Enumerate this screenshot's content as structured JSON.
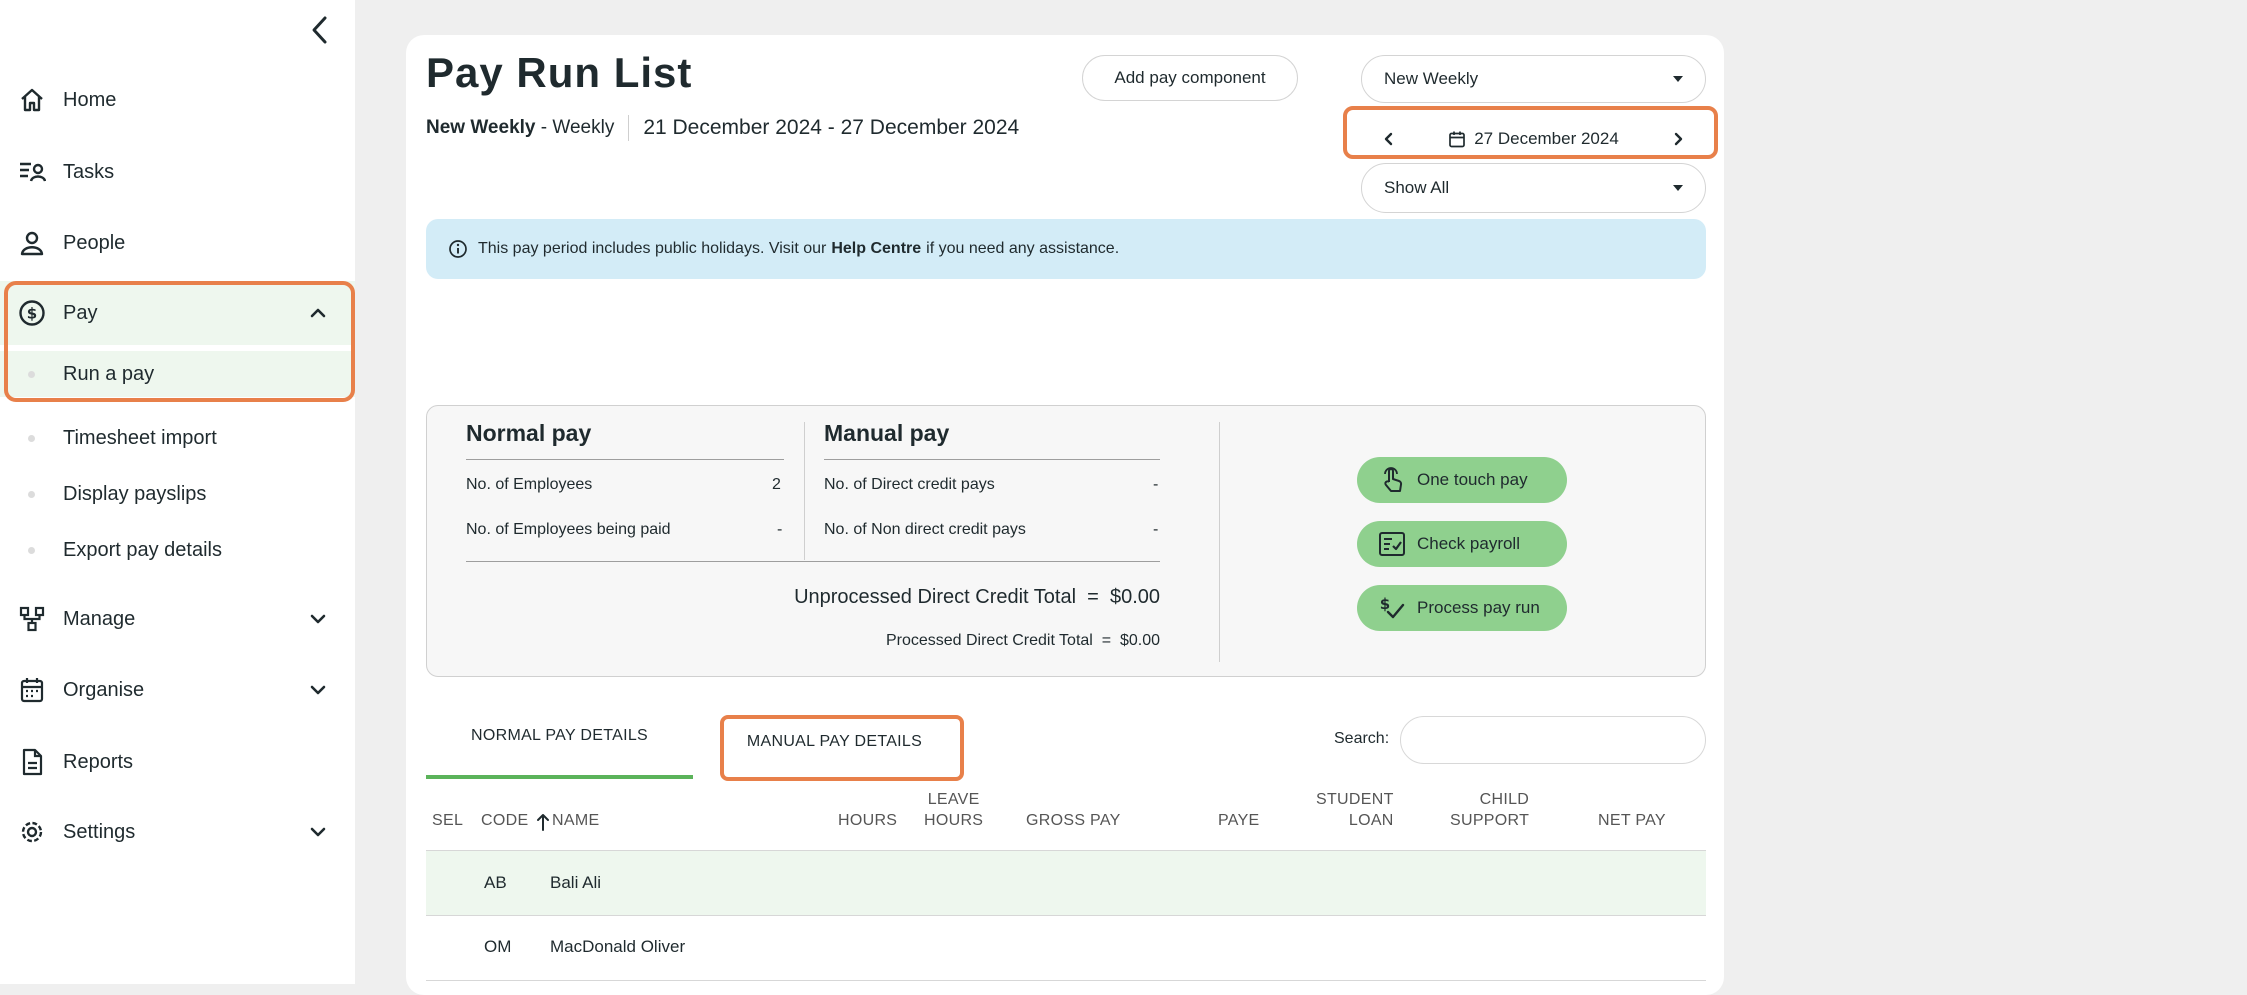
{
  "sidebar": {
    "items": [
      {
        "label": "Home",
        "icon": "home-icon"
      },
      {
        "label": "Tasks",
        "icon": "tasks-icon"
      },
      {
        "label": "People",
        "icon": "person-icon"
      },
      {
        "label": "Pay",
        "icon": "dollar-circle-icon",
        "expanded": true
      },
      {
        "label": "Manage",
        "icon": "hierarchy-icon"
      },
      {
        "label": "Organise",
        "icon": "calendar-icon"
      },
      {
        "label": "Reports",
        "icon": "document-icon"
      },
      {
        "label": "Settings",
        "icon": "gear-icon"
      }
    ],
    "pay_subitems": [
      "Run a pay",
      "Timesheet import",
      "Display payslips",
      "Export pay details"
    ],
    "active_subitem": "Run a pay"
  },
  "header": {
    "title": "Pay Run List",
    "subtitle_bold": "New Weekly",
    "subtitle_freq": " - Weekly",
    "date_range": "21 December 2024 - 27 December 2024",
    "add_component_label": "Add pay component",
    "pay_group_value": "New Weekly",
    "date_value": "27 December 2024",
    "filter_value": "Show All"
  },
  "alert": {
    "pre": "This pay period includes public holidays. Visit our",
    "link": "Help Centre",
    "post": "if you need any assistance."
  },
  "summary": {
    "normal": {
      "heading": "Normal pay",
      "rows": [
        {
          "label": "No. of Employees",
          "value": "2"
        },
        {
          "label": "No. of Employees being paid",
          "value": "-"
        }
      ]
    },
    "manual": {
      "heading": "Manual pay",
      "rows": [
        {
          "label": "No. of Direct credit pays",
          "value": "-"
        },
        {
          "label": "No. of Non direct credit pays",
          "value": "-"
        }
      ]
    },
    "unprocessed": "Unprocessed Direct Credit Total  =  $0.00",
    "processed": "Processed Direct Credit Total  =  $0.00",
    "actions": [
      "One touch pay",
      "Check payroll",
      "Process pay run"
    ]
  },
  "tabs": [
    "NORMAL PAY DETAILS",
    "MANUAL PAY DETAILS"
  ],
  "active_tab": "NORMAL PAY DETAILS",
  "search": {
    "label": "Search:",
    "value": ""
  },
  "table": {
    "columns": {
      "sel": "SEL",
      "code": "CODE",
      "name": "NAME",
      "hours": "HOURS",
      "leave_hours_1": "LEAVE",
      "leave_hours_2": "HOURS",
      "gross_pay": "GROSS PAY",
      "paye": "PAYE",
      "student_loan_1": "STUDENT",
      "student_loan_2": "LOAN",
      "child_support_1": "CHILD",
      "child_support_2": "SUPPORT",
      "net_pay": "NET PAY"
    },
    "rows": [
      {
        "code": "AB",
        "name": "Bali Ali"
      },
      {
        "code": "OM",
        "name": "MacDonald Oliver"
      }
    ]
  },
  "colors": {
    "accent_green": "#5bb35a",
    "action_green": "#8fd08e",
    "highlight_orange": "#e8804a",
    "alert_blue": "#d3ecf7"
  }
}
